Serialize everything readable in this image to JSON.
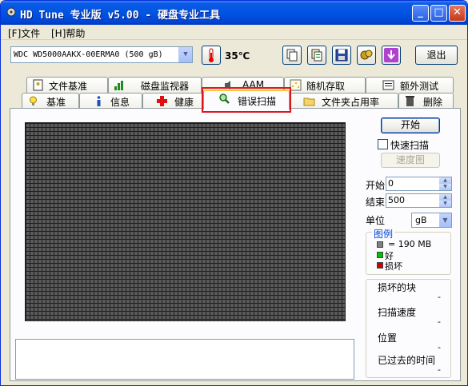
{
  "window": {
    "title": "HD Tune 专业版 v5.00 - 硬盘专业工具",
    "minimize": "_",
    "maximize": "□",
    "close": "✕"
  },
  "menu": {
    "items": [
      {
        "label": "[F]文件"
      },
      {
        "label": "[H]帮助"
      }
    ]
  },
  "toolbar": {
    "drive": "WDC WD5000AAKX-00ERMA0 (500 gB)",
    "temperature": "35℃",
    "exit_label": "退出"
  },
  "tabs_row1": [
    {
      "label": "文件基准",
      "icon": "file-benchmark-icon"
    },
    {
      "label": "磁盘监视器",
      "icon": "disk-monitor-icon"
    },
    {
      "label": "AAM",
      "icon": "speaker-icon"
    },
    {
      "label": "随机存取",
      "icon": "random-access-icon"
    },
    {
      "label": "额外测试",
      "icon": "extra-tests-icon"
    }
  ],
  "tabs_row2": [
    {
      "label": "基准",
      "icon": "lightbulb-icon"
    },
    {
      "label": "信息",
      "icon": "info-icon"
    },
    {
      "label": "健康",
      "icon": "health-cross-icon"
    },
    {
      "label": "错误扫描",
      "icon": "magnifier-icon",
      "active": true
    },
    {
      "label": "文件夹占用率",
      "icon": "folder-icon"
    },
    {
      "label": "删除",
      "icon": "trash-icon"
    }
  ],
  "scan": {
    "start_label": "开始",
    "quick_scan_label": "快速扫描",
    "quick_scan_checked": false,
    "speed_map_label": "速度图",
    "start_field_label": "开始",
    "start_value": "0",
    "end_field_label": "结束",
    "end_value": "500",
    "unit_label": "单位",
    "unit_value": "gB"
  },
  "legend": {
    "title": "图例",
    "block_size": "= 190 MB",
    "good": "好",
    "bad": "损坏",
    "colors": {
      "block": "#808080",
      "good": "#00C000",
      "bad": "#D00000"
    }
  },
  "stats": {
    "damaged_blocks_label": "损坏的块",
    "damaged_blocks_value": "-",
    "scan_speed_label": "扫描速度",
    "scan_speed_value": "-",
    "position_label": "位置",
    "position_value": "-",
    "elapsed_label": "已过去的时间",
    "elapsed_value": "-"
  }
}
